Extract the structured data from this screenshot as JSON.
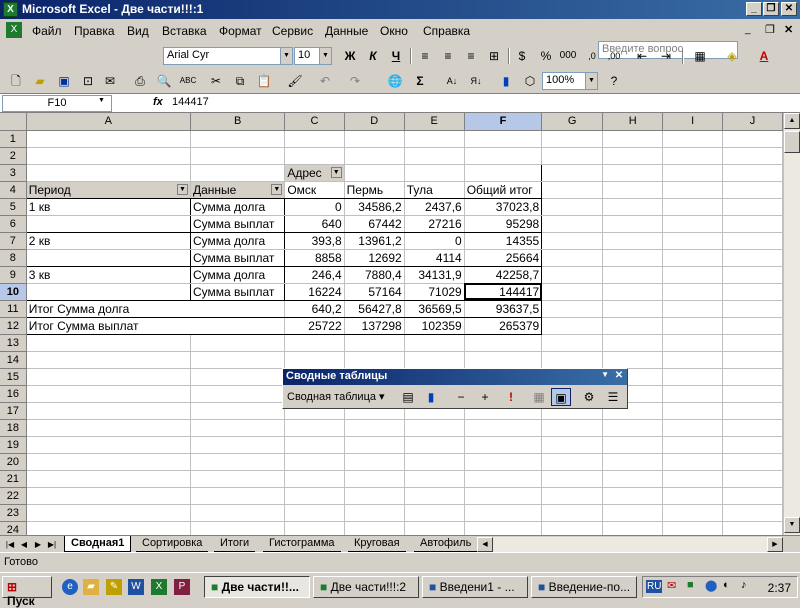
{
  "window": {
    "title": "Microsoft Excel - Две части!!!:1"
  },
  "menu": [
    "Файл",
    "Правка",
    "Вид",
    "Вставка",
    "Формат",
    "Сервис",
    "Данные",
    "Окно",
    "Справка"
  ],
  "help_placeholder": "Введите вопрос",
  "format_toolbar": {
    "font": "Arial Cyr",
    "size": "10",
    "bold": "Ж",
    "italic": "К",
    "underline": "Ч"
  },
  "std_toolbar": {
    "zoom": "100%",
    "sigma": "Σ"
  },
  "formula": {
    "name_box": "F10",
    "fx": "fx",
    "value": "144417"
  },
  "columns": [
    "A",
    "B",
    "C",
    "D",
    "E",
    "F",
    "G",
    "H",
    "I",
    "J"
  ],
  "rows": [
    "1",
    "2",
    "3",
    "4",
    "5",
    "6",
    "7",
    "8",
    "9",
    "10",
    "11",
    "12",
    "13",
    "14",
    "15",
    "16",
    "17",
    "18",
    "19",
    "20",
    "21",
    "22",
    "23",
    "24"
  ],
  "pivot": {
    "col_field": "Адрес",
    "row_field": "Период",
    "data_field": "Данные",
    "col_headers": [
      "Омск",
      "Пермь",
      "Тула",
      "Общий итог"
    ],
    "rows": [
      {
        "period": "1 кв",
        "label": "Сумма долга",
        "values": [
          "0",
          "34586,2",
          "2437,6",
          "37023,8"
        ]
      },
      {
        "period": "",
        "label": "Сумма выплат",
        "values": [
          "640",
          "67442",
          "27216",
          "95298"
        ]
      },
      {
        "period": "2 кв",
        "label": "Сумма долга",
        "values": [
          "393,8",
          "13961,2",
          "0",
          "14355"
        ]
      },
      {
        "period": "",
        "label": "Сумма выплат",
        "values": [
          "8858",
          "12692",
          "4114",
          "25664"
        ]
      },
      {
        "period": "3 кв",
        "label": "Сумма долга",
        "values": [
          "246,4",
          "7880,4",
          "34131,9",
          "42258,7"
        ]
      },
      {
        "period": "",
        "label": "Сумма выплат",
        "values": [
          "16224",
          "57164",
          "71029",
          "144417"
        ]
      }
    ],
    "totals": [
      {
        "label": "Итог Сумма долга",
        "values": [
          "640,2",
          "56427,8",
          "36569,5",
          "93637,5"
        ]
      },
      {
        "label": "Итог Сумма выплат",
        "values": [
          "25722",
          "137298",
          "102359",
          "265379"
        ]
      }
    ]
  },
  "sheet_tabs": [
    "Сводная1",
    "Сортировка",
    "Итоги",
    "Гистограмма",
    "Круговая",
    "Автофиль"
  ],
  "status": "Готово",
  "pivot_toolbar": {
    "title": "Сводные таблицы",
    "menu": "Сводная таблица ▾"
  },
  "taskbar": {
    "start": "Пуск",
    "tasks": [
      "Две части!!...",
      "Две части!!!:2",
      "Введени1 - ...",
      "Введение-по..."
    ],
    "lang": "RU",
    "clock": "2:37"
  }
}
